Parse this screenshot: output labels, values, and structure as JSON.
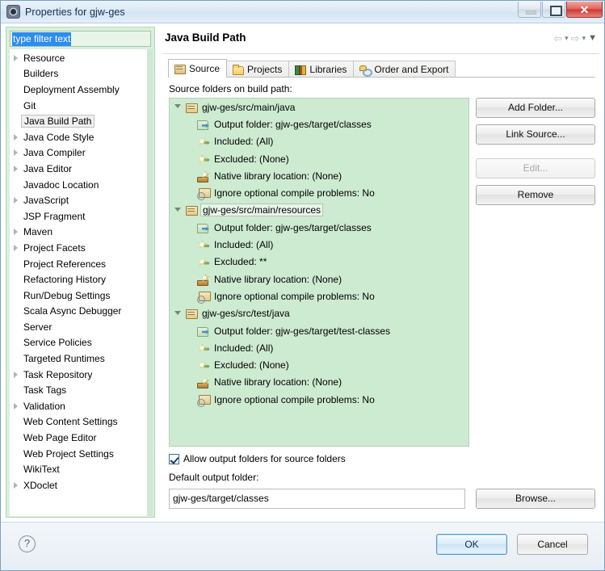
{
  "window": {
    "title": "Properties for gjw-ges",
    "icon": "properties-icon",
    "buttons": {
      "minimize": "–",
      "maximize": "□",
      "close": "✕"
    }
  },
  "sidebar": {
    "filter": {
      "value": "type filter text",
      "placeholder": "type filter text"
    },
    "items": [
      {
        "label": "Resource",
        "expandable": true,
        "selected": false
      },
      {
        "label": "Builders",
        "expandable": false,
        "selected": false
      },
      {
        "label": "Deployment Assembly",
        "expandable": false,
        "selected": false
      },
      {
        "label": "Git",
        "expandable": false,
        "selected": false
      },
      {
        "label": "Java Build Path",
        "expandable": false,
        "selected": true
      },
      {
        "label": "Java Code Style",
        "expandable": true,
        "selected": false
      },
      {
        "label": "Java Compiler",
        "expandable": true,
        "selected": false
      },
      {
        "label": "Java Editor",
        "expandable": true,
        "selected": false
      },
      {
        "label": "Javadoc Location",
        "expandable": false,
        "selected": false
      },
      {
        "label": "JavaScript",
        "expandable": true,
        "selected": false
      },
      {
        "label": "JSP Fragment",
        "expandable": false,
        "selected": false
      },
      {
        "label": "Maven",
        "expandable": true,
        "selected": false
      },
      {
        "label": "Project Facets",
        "expandable": true,
        "selected": false
      },
      {
        "label": "Project References",
        "expandable": false,
        "selected": false
      },
      {
        "label": "Refactoring History",
        "expandable": false,
        "selected": false
      },
      {
        "label": "Run/Debug Settings",
        "expandable": false,
        "selected": false
      },
      {
        "label": "Scala Async Debugger",
        "expandable": false,
        "selected": false
      },
      {
        "label": "Server",
        "expandable": false,
        "selected": false
      },
      {
        "label": "Service Policies",
        "expandable": false,
        "selected": false
      },
      {
        "label": "Targeted Runtimes",
        "expandable": false,
        "selected": false
      },
      {
        "label": "Task Repository",
        "expandable": true,
        "selected": false
      },
      {
        "label": "Task Tags",
        "expandable": false,
        "selected": false
      },
      {
        "label": "Validation",
        "expandable": true,
        "selected": false
      },
      {
        "label": "Web Content Settings",
        "expandable": false,
        "selected": false
      },
      {
        "label": "Web Page Editor",
        "expandable": false,
        "selected": false
      },
      {
        "label": "Web Project Settings",
        "expandable": false,
        "selected": false
      },
      {
        "label": "WikiText",
        "expandable": false,
        "selected": false
      },
      {
        "label": "XDoclet",
        "expandable": true,
        "selected": false
      }
    ]
  },
  "page": {
    "title": "Java Build Path",
    "nav": {
      "back": "⇦",
      "back_caret": "▾",
      "forward": "⇨",
      "forward_caret": "▾",
      "menu_caret": "▼"
    }
  },
  "tabs": [
    {
      "label": "Source",
      "icon": "source-folder-icon",
      "active": true
    },
    {
      "label": "Projects",
      "icon": "folder-icon",
      "active": false
    },
    {
      "label": "Libraries",
      "icon": "books-icon",
      "active": false
    },
    {
      "label": "Order and Export",
      "icon": "key-icon",
      "active": false
    }
  ],
  "source": {
    "heading": "Source folders on build path:",
    "folders": [
      {
        "path": "gjw-ges/src/main/java",
        "selected": false,
        "details": [
          {
            "icon": "output-folder-icon",
            "text": "Output folder: gjw-ges/target/classes"
          },
          {
            "icon": "included-filter-icon",
            "text": "Included: (All)"
          },
          {
            "icon": "excluded-filter-icon",
            "text": "Excluded: (None)"
          },
          {
            "icon": "native-library-icon",
            "text": "Native library location: (None)"
          },
          {
            "icon": "ignore-problems-icon",
            "text": "Ignore optional compile problems: No"
          }
        ]
      },
      {
        "path": "gjw-ges/src/main/resources",
        "selected": true,
        "details": [
          {
            "icon": "output-folder-icon",
            "text": "Output folder: gjw-ges/target/classes"
          },
          {
            "icon": "included-filter-icon",
            "text": "Included: (All)"
          },
          {
            "icon": "excluded-filter-icon",
            "text": "Excluded: **"
          },
          {
            "icon": "native-library-icon",
            "text": "Native library location: (None)"
          },
          {
            "icon": "ignore-problems-icon",
            "text": "Ignore optional compile problems: No"
          }
        ]
      },
      {
        "path": "gjw-ges/src/test/java",
        "selected": false,
        "details": [
          {
            "icon": "output-folder-icon",
            "text": "Output folder: gjw-ges/target/test-classes"
          },
          {
            "icon": "included-filter-icon",
            "text": "Included: (All)"
          },
          {
            "icon": "excluded-filter-icon",
            "text": "Excluded: (None)"
          },
          {
            "icon": "native-library-icon",
            "text": "Native library location: (None)"
          },
          {
            "icon": "ignore-problems-icon",
            "text": "Ignore optional compile problems: No"
          }
        ]
      }
    ],
    "buttons": {
      "add_folder": "Add Folder...",
      "link_source": "Link Source...",
      "edit": "Edit...",
      "edit_disabled": true,
      "remove": "Remove"
    },
    "allow_output_folders": {
      "label": "Allow output folders for source folders",
      "checked": true
    },
    "default_output": {
      "label": "Default output folder:",
      "value": "gjw-ges/target/classes",
      "browse": "Browse..."
    }
  },
  "footer": {
    "help": "?",
    "ok": "OK",
    "cancel": "Cancel"
  }
}
